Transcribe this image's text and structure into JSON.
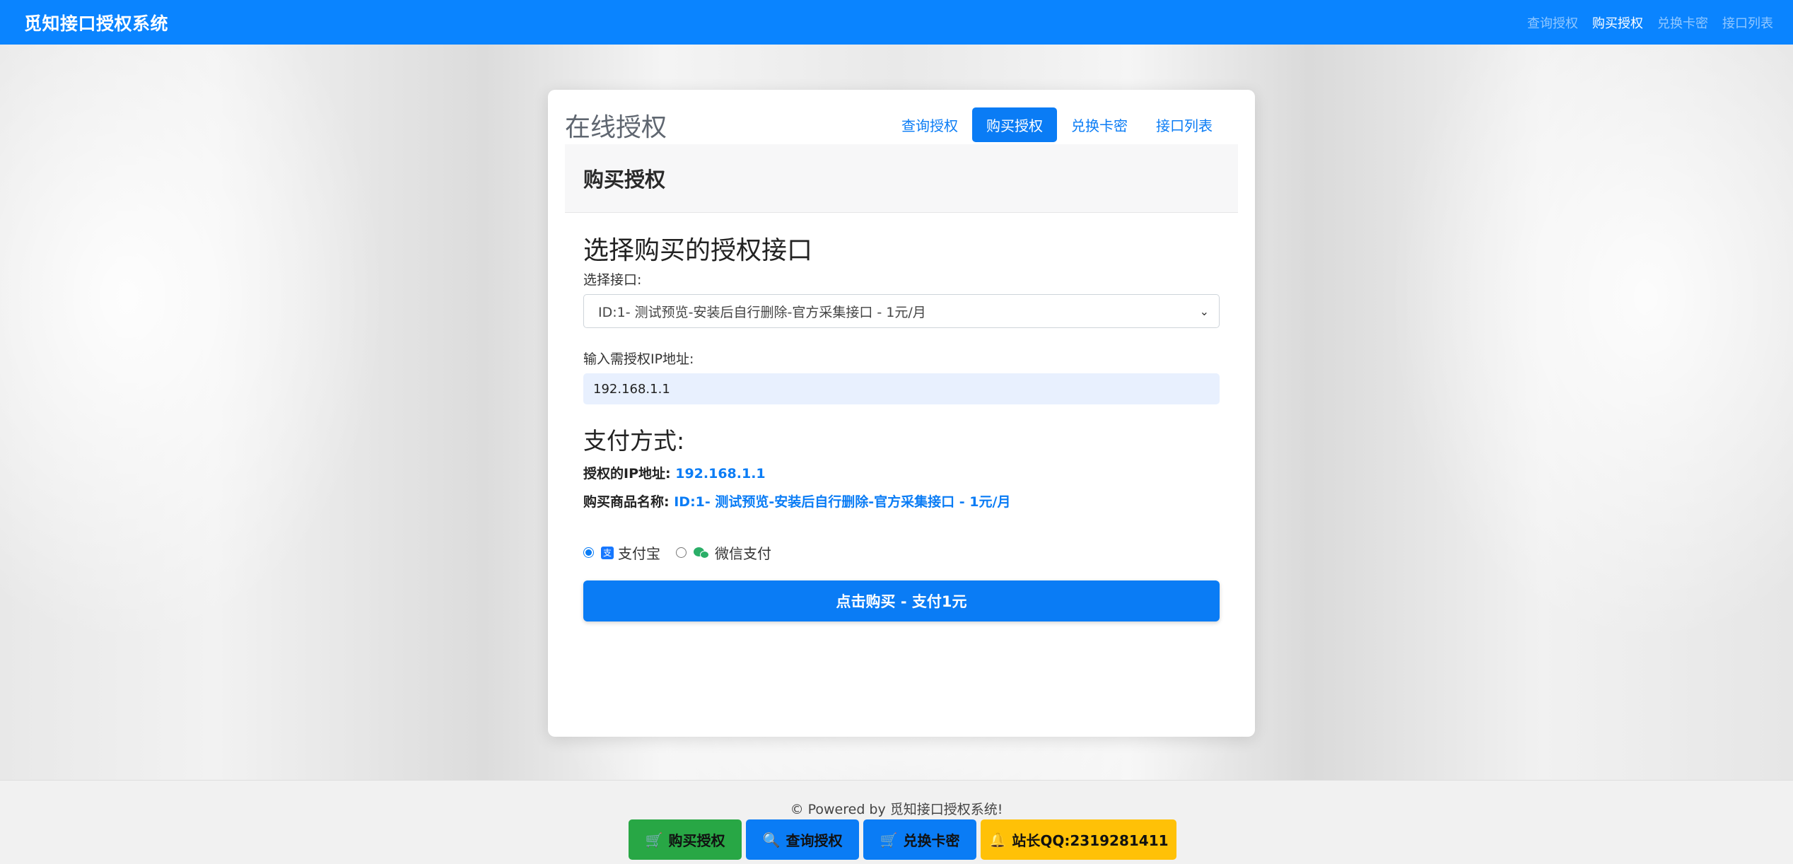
{
  "navbar": {
    "brand": "觅知接口授权系统",
    "links": [
      "查询授权",
      "购买授权",
      "兑换卡密",
      "接口列表"
    ]
  },
  "card": {
    "title": "在线授权",
    "tabs": [
      "查询授权",
      "购买授权",
      "兑换卡密",
      "接口列表"
    ],
    "panel_title": "购买授权"
  },
  "form": {
    "section_title": "选择购买的授权接口",
    "select_label": "选择接口:",
    "select_value": "ID:1- 测试预览-安装后自行删除-官方采集接口 - 1元/月",
    "ip_label": "输入需授权IP地址:",
    "ip_value": "192.168.1.1"
  },
  "payment": {
    "section_title": "支付方式:",
    "ip_info_label": "授权的IP地址:",
    "ip_info_value": "192.168.1.1",
    "product_label": "购买商品名称:",
    "product_value": "ID:1- 测试预览-安装后自行删除-官方采集接口 - 1元/月",
    "options": [
      {
        "label": "支付宝",
        "icon": "alipay-icon",
        "selected": true
      },
      {
        "label": "微信支付",
        "icon": "wechat-icon",
        "selected": false
      }
    ],
    "buy_button": "点击购买 - 支付1元"
  },
  "footer": {
    "powered": "© Powered by 觅知接口授权系统!",
    "buttons": [
      {
        "label": "购买授权",
        "icon": "cart-icon"
      },
      {
        "label": "查询授权",
        "icon": "search-icon"
      },
      {
        "label": "兑换卡密",
        "icon": "cart-icon"
      },
      {
        "label": "站长QQ:2319281411",
        "icon": "qq-icon"
      }
    ]
  },
  "colors": {
    "primary": "#0a84ff",
    "success": "#28a745",
    "warning": "#ffc107"
  }
}
